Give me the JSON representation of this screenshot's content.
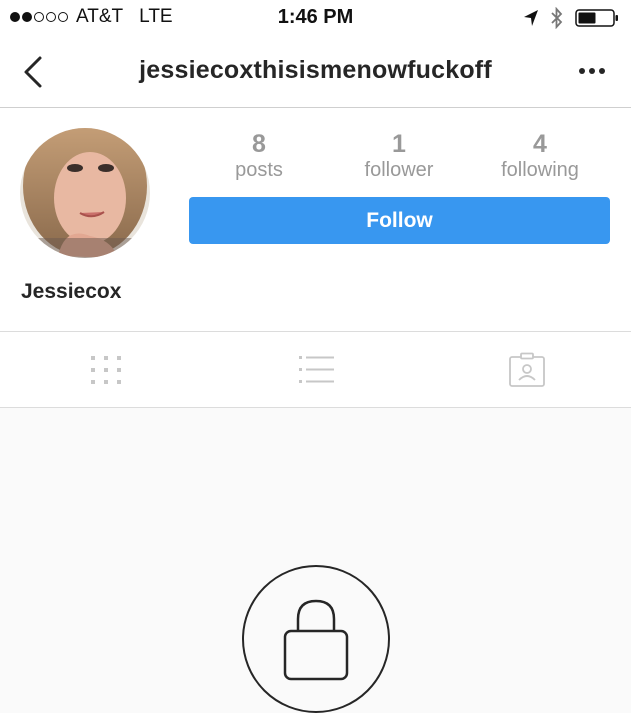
{
  "status_bar": {
    "carrier": "AT&T",
    "network": "LTE",
    "time": "1:46 PM",
    "signal_bars_filled": 2,
    "signal_bars_total": 5,
    "battery_level": 0.5
  },
  "nav": {
    "title": "jessiecoxthisismenowfuckoff",
    "back_icon": "chevron-left-icon",
    "more_icon": "more-horizontal-icon"
  },
  "profile": {
    "display_name": "Jessiecox",
    "stats": [
      {
        "value": "8",
        "label": "posts"
      },
      {
        "value": "1",
        "label": "follower"
      },
      {
        "value": "4",
        "label": "following"
      }
    ],
    "follow_label": "Follow"
  },
  "tabs": [
    {
      "icon": "grid-icon"
    },
    {
      "icon": "list-icon"
    },
    {
      "icon": "tagged-photos-icon"
    }
  ],
  "private_icon": "lock-icon",
  "colors": {
    "accent": "#3897f0",
    "stat_gray": "#999999",
    "background": "#fafafa"
  }
}
